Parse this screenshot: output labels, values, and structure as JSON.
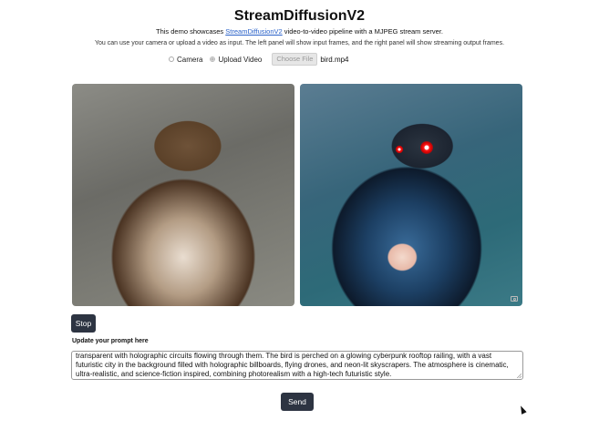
{
  "header": {
    "title": "StreamDiffusionV2",
    "desc_prefix": "This demo showcases ",
    "desc_link": "StreamDiffusionV2",
    "desc_suffix": " video-to-video pipeline with a MJPEG stream server.",
    "instructions": "You can use your camera or upload a video as input. The left panel will show input frames, and the right panel will show streaming output frames."
  },
  "input_source": {
    "options": [
      "Camera",
      "Upload Video"
    ],
    "selected": "Upload Video",
    "file_button_label": "Choose File",
    "file_name": "bird.mp4"
  },
  "panels": {
    "input_frame_icon": "bird-input-frame",
    "output_frame_icon": "bird-output-frame",
    "snapshot_icon": "camera-icon"
  },
  "controls": {
    "stop_label": "Stop",
    "prompt_label": "Update your prompt here",
    "prompt_value": "transparent with holographic circuits flowing through them. The bird is perched on a glowing cyberpunk rooftop railing, with a vast futuristic city in the background filled with holographic billboards, flying drones, and neon-lit skyscrapers. The atmosphere is cinematic, ultra-realistic, and science-fiction inspired, combining photorealism with a high-tech futuristic style.",
    "send_label": "Send"
  },
  "colors": {
    "button_bg": "#2d3442",
    "link": "#2a62c9",
    "eye_glow": "#ff1a1a"
  }
}
